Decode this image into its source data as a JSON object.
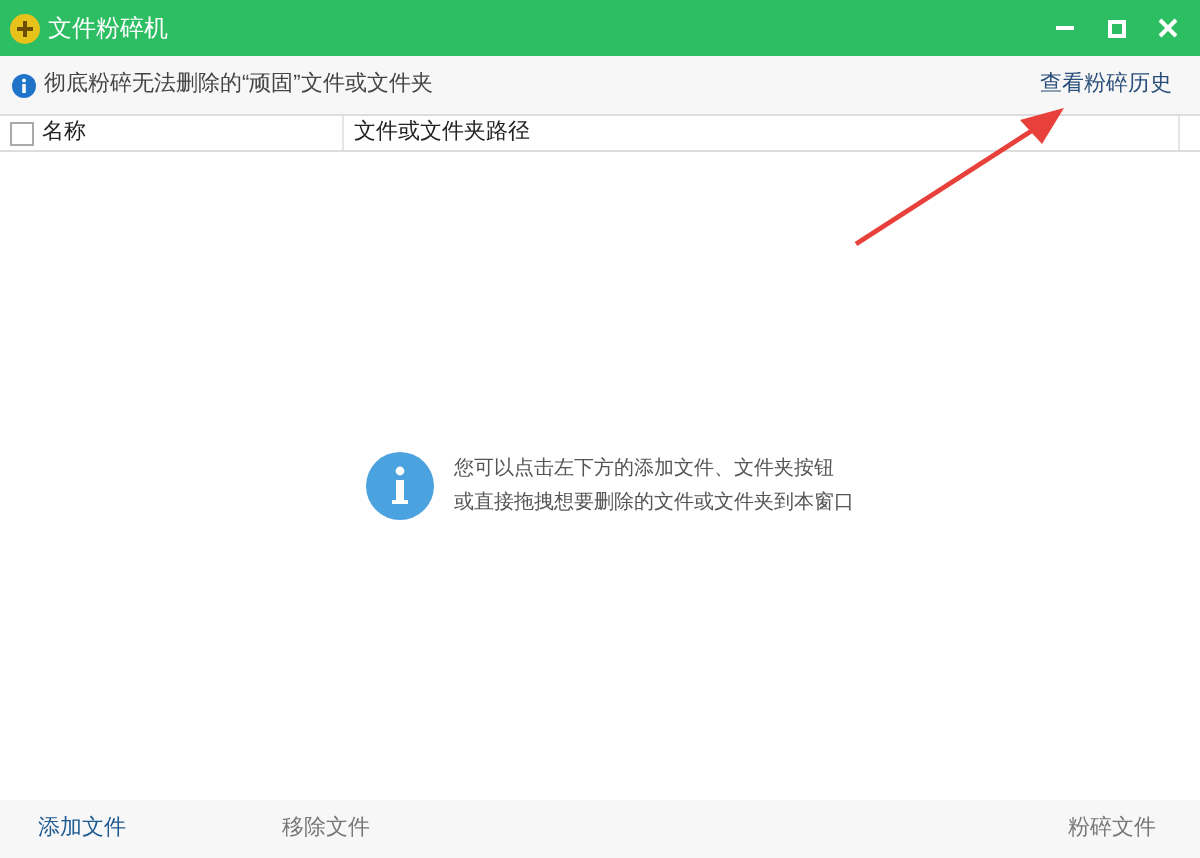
{
  "window": {
    "title": "文件粉碎机"
  },
  "notice": {
    "text": "彻底粉碎无法删除的“顽固”文件或文件夹",
    "link": "查看粉碎历史"
  },
  "table": {
    "select_all": {
      "checked": false
    },
    "columns": [
      "名称",
      "文件或文件夹路径"
    ]
  },
  "empty_hint": {
    "lines": [
      "您可以点击左下方的添加文件、文件夹按钮",
      "或直接拖拽想要删除的文件或文件夹到本窗口"
    ]
  },
  "annotation": {
    "kind": "arrow"
  },
  "footer": {
    "buttons": [
      {
        "label": "添加文件",
        "disabled": false
      },
      {
        "label": "移除文件",
        "disabled": true
      },
      {
        "label": "粉碎文件",
        "disabled": true
      }
    ]
  }
}
